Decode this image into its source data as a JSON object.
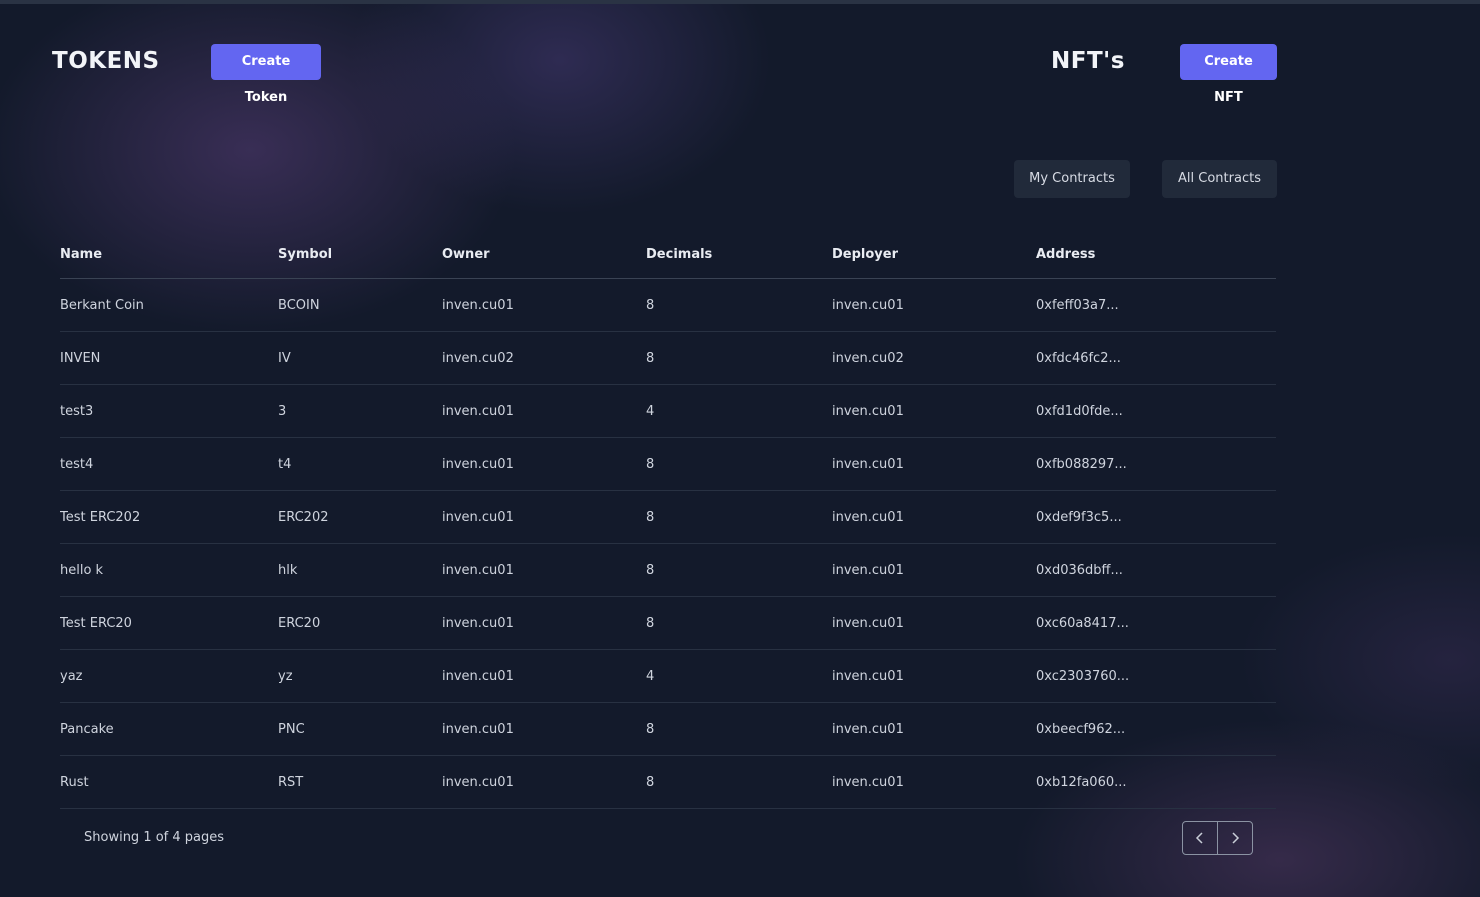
{
  "tokens_section": {
    "title": "TOKENS",
    "create_label": "Create Token"
  },
  "nfts_section": {
    "title": "NFT's",
    "create_label": "Create NFT"
  },
  "filters": {
    "my_contracts": "My Contracts",
    "all_contracts": "All Contracts"
  },
  "table": {
    "headers": [
      "Name",
      "Symbol",
      "Owner",
      "Decimals",
      "Deployer",
      "Address"
    ],
    "rows": [
      [
        "Berkant Coin",
        "BCOIN",
        "inven.cu01",
        "8",
        "inven.cu01",
        "0xfeff03a7..."
      ],
      [
        "INVEN",
        "IV",
        "inven.cu02",
        "8",
        "inven.cu02",
        "0xfdc46fc2..."
      ],
      [
        "test3",
        "3",
        "inven.cu01",
        "4",
        "inven.cu01",
        "0xfd1d0fde..."
      ],
      [
        "test4",
        "t4",
        "inven.cu01",
        "8",
        "inven.cu01",
        "0xfb088297..."
      ],
      [
        "Test ERC202",
        "ERC202",
        "inven.cu01",
        "8",
        "inven.cu01",
        "0xdef9f3c5..."
      ],
      [
        "hello k",
        "hlk",
        "inven.cu01",
        "8",
        "inven.cu01",
        "0xd036dbff..."
      ],
      [
        "Test ERC20",
        "ERC20",
        "inven.cu01",
        "8",
        "inven.cu01",
        "0xc60a8417..."
      ],
      [
        "yaz",
        "yz",
        "inven.cu01",
        "4",
        "inven.cu01",
        "0xc2303760..."
      ],
      [
        "Pancake",
        "PNC",
        "inven.cu01",
        "8",
        "inven.cu01",
        "0xbeecf962..."
      ],
      [
        "Rust",
        "RST",
        "inven.cu01",
        "8",
        "inven.cu01",
        "0xb12fa060..."
      ]
    ]
  },
  "pagination": {
    "status": "Showing 1 of 4 pages",
    "prev_icon": "chevron-left-icon",
    "next_icon": "chevron-right-icon"
  },
  "colors": {
    "accent": "#6366f1",
    "background": "#131a2b",
    "button_dark": "#212a3a"
  }
}
